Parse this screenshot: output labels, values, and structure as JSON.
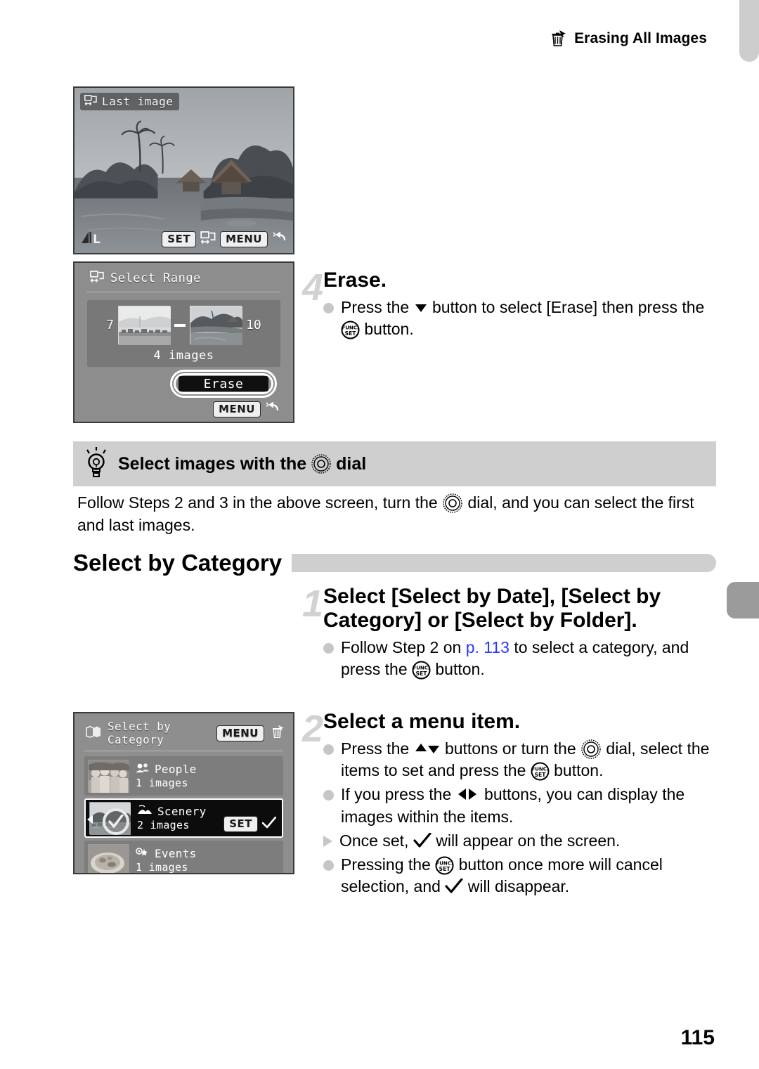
{
  "header": {
    "title": "Erasing All Images",
    "icon": "erase-all-icon"
  },
  "screens": {
    "last_image": {
      "label": "Last image",
      "quality_badge": "L",
      "set_badge": "SET",
      "menu_badge": "MENU",
      "range_icon": "select-range-icon",
      "back_icon": "back-arrow-icon"
    },
    "select_range": {
      "title": "Select Range",
      "first_number": "7",
      "last_number": "10",
      "count": "4 images",
      "erase_label": "Erase",
      "menu_badge": "MENU",
      "back_icon": "back-arrow-icon"
    },
    "select_by_category": {
      "title": "Select by Category",
      "menu_badge": "MENU",
      "erase_icon": "erase-all-icon",
      "set_badge": "SET",
      "items": [
        {
          "name": "People",
          "count": "1 images",
          "icon": "people-icon",
          "selected": false
        },
        {
          "name": "Scenery",
          "count": "2 images",
          "icon": "scenery-icon",
          "selected": true
        },
        {
          "name": "Events",
          "count": "1 images",
          "icon": "events-icon",
          "selected": false
        }
      ]
    }
  },
  "step4": {
    "number": "4",
    "heading": "Erase.",
    "bullet_1a": "Press the",
    "bullet_1b": "button to select [Erase] then",
    "bullet_1c": "press the",
    "bullet_1d": "button."
  },
  "tip": {
    "title_a": "Select images with the",
    "title_b": "dial",
    "body_a": "Follow Steps 2 and 3 in the above screen, turn the",
    "body_b": "dial, and you can select the first and last images."
  },
  "section": {
    "title": "Select by Category"
  },
  "step1": {
    "number": "1",
    "heading": "Select [Select by Date], [Select by Category] or [Select by Folder].",
    "bullet_1a": "Follow Step 2 on",
    "bullet_1_link": "p. 113",
    "bullet_1b": "to select a category, and press the",
    "bullet_1c": "button."
  },
  "step2": {
    "number": "2",
    "heading": "Select a menu item.",
    "bullet_1a": "Press the",
    "bullet_1b": "buttons or turn the",
    "bullet_1c": "dial, select the items to set and press the",
    "bullet_1d": "button.",
    "bullet_2a": "If you press the",
    "bullet_2b": "buttons, you can display the images within the items.",
    "bullet_3a": "Once set,",
    "bullet_3b": "will appear on the screen.",
    "bullet_4a": "Pressing the",
    "bullet_4b": "button once more will cancel selection, and",
    "bullet_4c": "will disappear."
  },
  "folio": {
    "page": "115"
  },
  "colors": {
    "link": "#2a37ff",
    "tip_bg": "#cfcfcf",
    "step_num": "#d2d2d2"
  }
}
